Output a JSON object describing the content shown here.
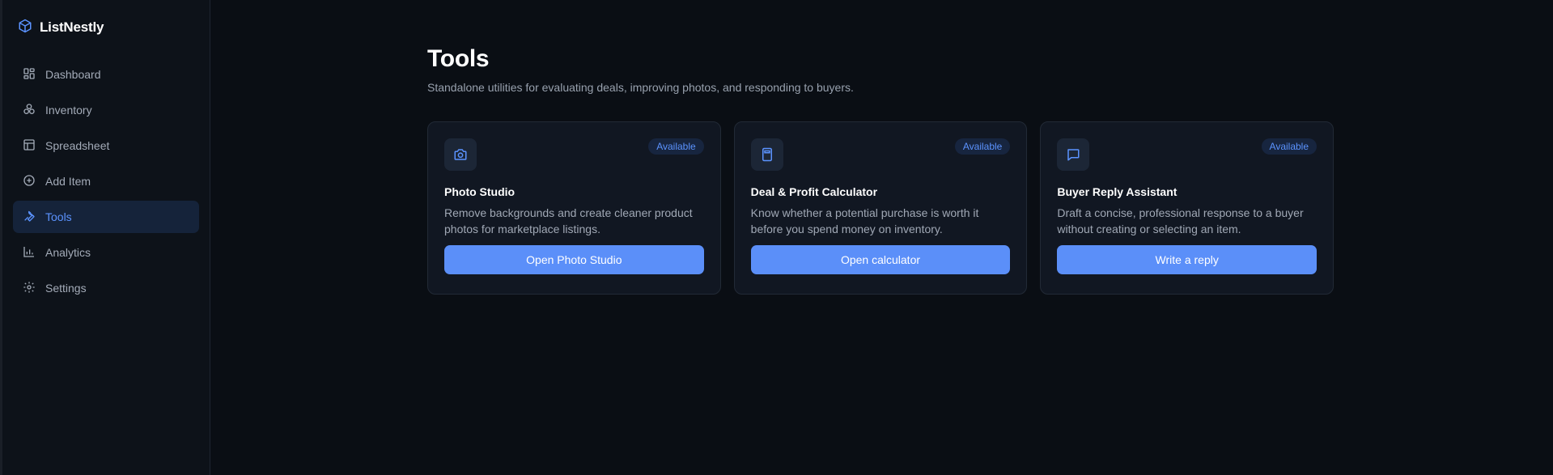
{
  "app": {
    "name": "ListNestly"
  },
  "sidebar": {
    "items": [
      {
        "label": "Dashboard",
        "icon": "dashboard-icon",
        "active": false
      },
      {
        "label": "Inventory",
        "icon": "boxes-icon",
        "active": false
      },
      {
        "label": "Spreadsheet",
        "icon": "table-icon",
        "active": false
      },
      {
        "label": "Add Item",
        "icon": "plus-circle-icon",
        "active": false
      },
      {
        "label": "Tools",
        "icon": "wrench-icon",
        "active": true
      },
      {
        "label": "Analytics",
        "icon": "bar-chart-icon",
        "active": false
      },
      {
        "label": "Settings",
        "icon": "gear-icon",
        "active": false
      }
    ]
  },
  "main": {
    "title": "Tools",
    "subtitle": "Standalone utilities for evaluating deals, improving photos, and responding to buyers.",
    "cards": [
      {
        "icon": "camera-icon",
        "badge": "Available",
        "title": "Photo Studio",
        "description": "Remove backgrounds and create cleaner product photos for marketplace listings.",
        "button": "Open Photo Studio"
      },
      {
        "icon": "calculator-icon",
        "badge": "Available",
        "title": "Deal & Profit Calculator",
        "description": "Know whether a potential purchase is worth it before you spend money on inventory.",
        "button": "Open calculator"
      },
      {
        "icon": "message-icon",
        "badge": "Available",
        "title": "Buyer Reply Assistant",
        "description": "Draft a concise, professional response to a buyer without creating or selecting an item.",
        "button": "Write a reply"
      }
    ]
  },
  "colors": {
    "accent": "#5b8ff9",
    "background": "#0a0e14",
    "sidebar": "#0d1219",
    "card": "#111722"
  }
}
